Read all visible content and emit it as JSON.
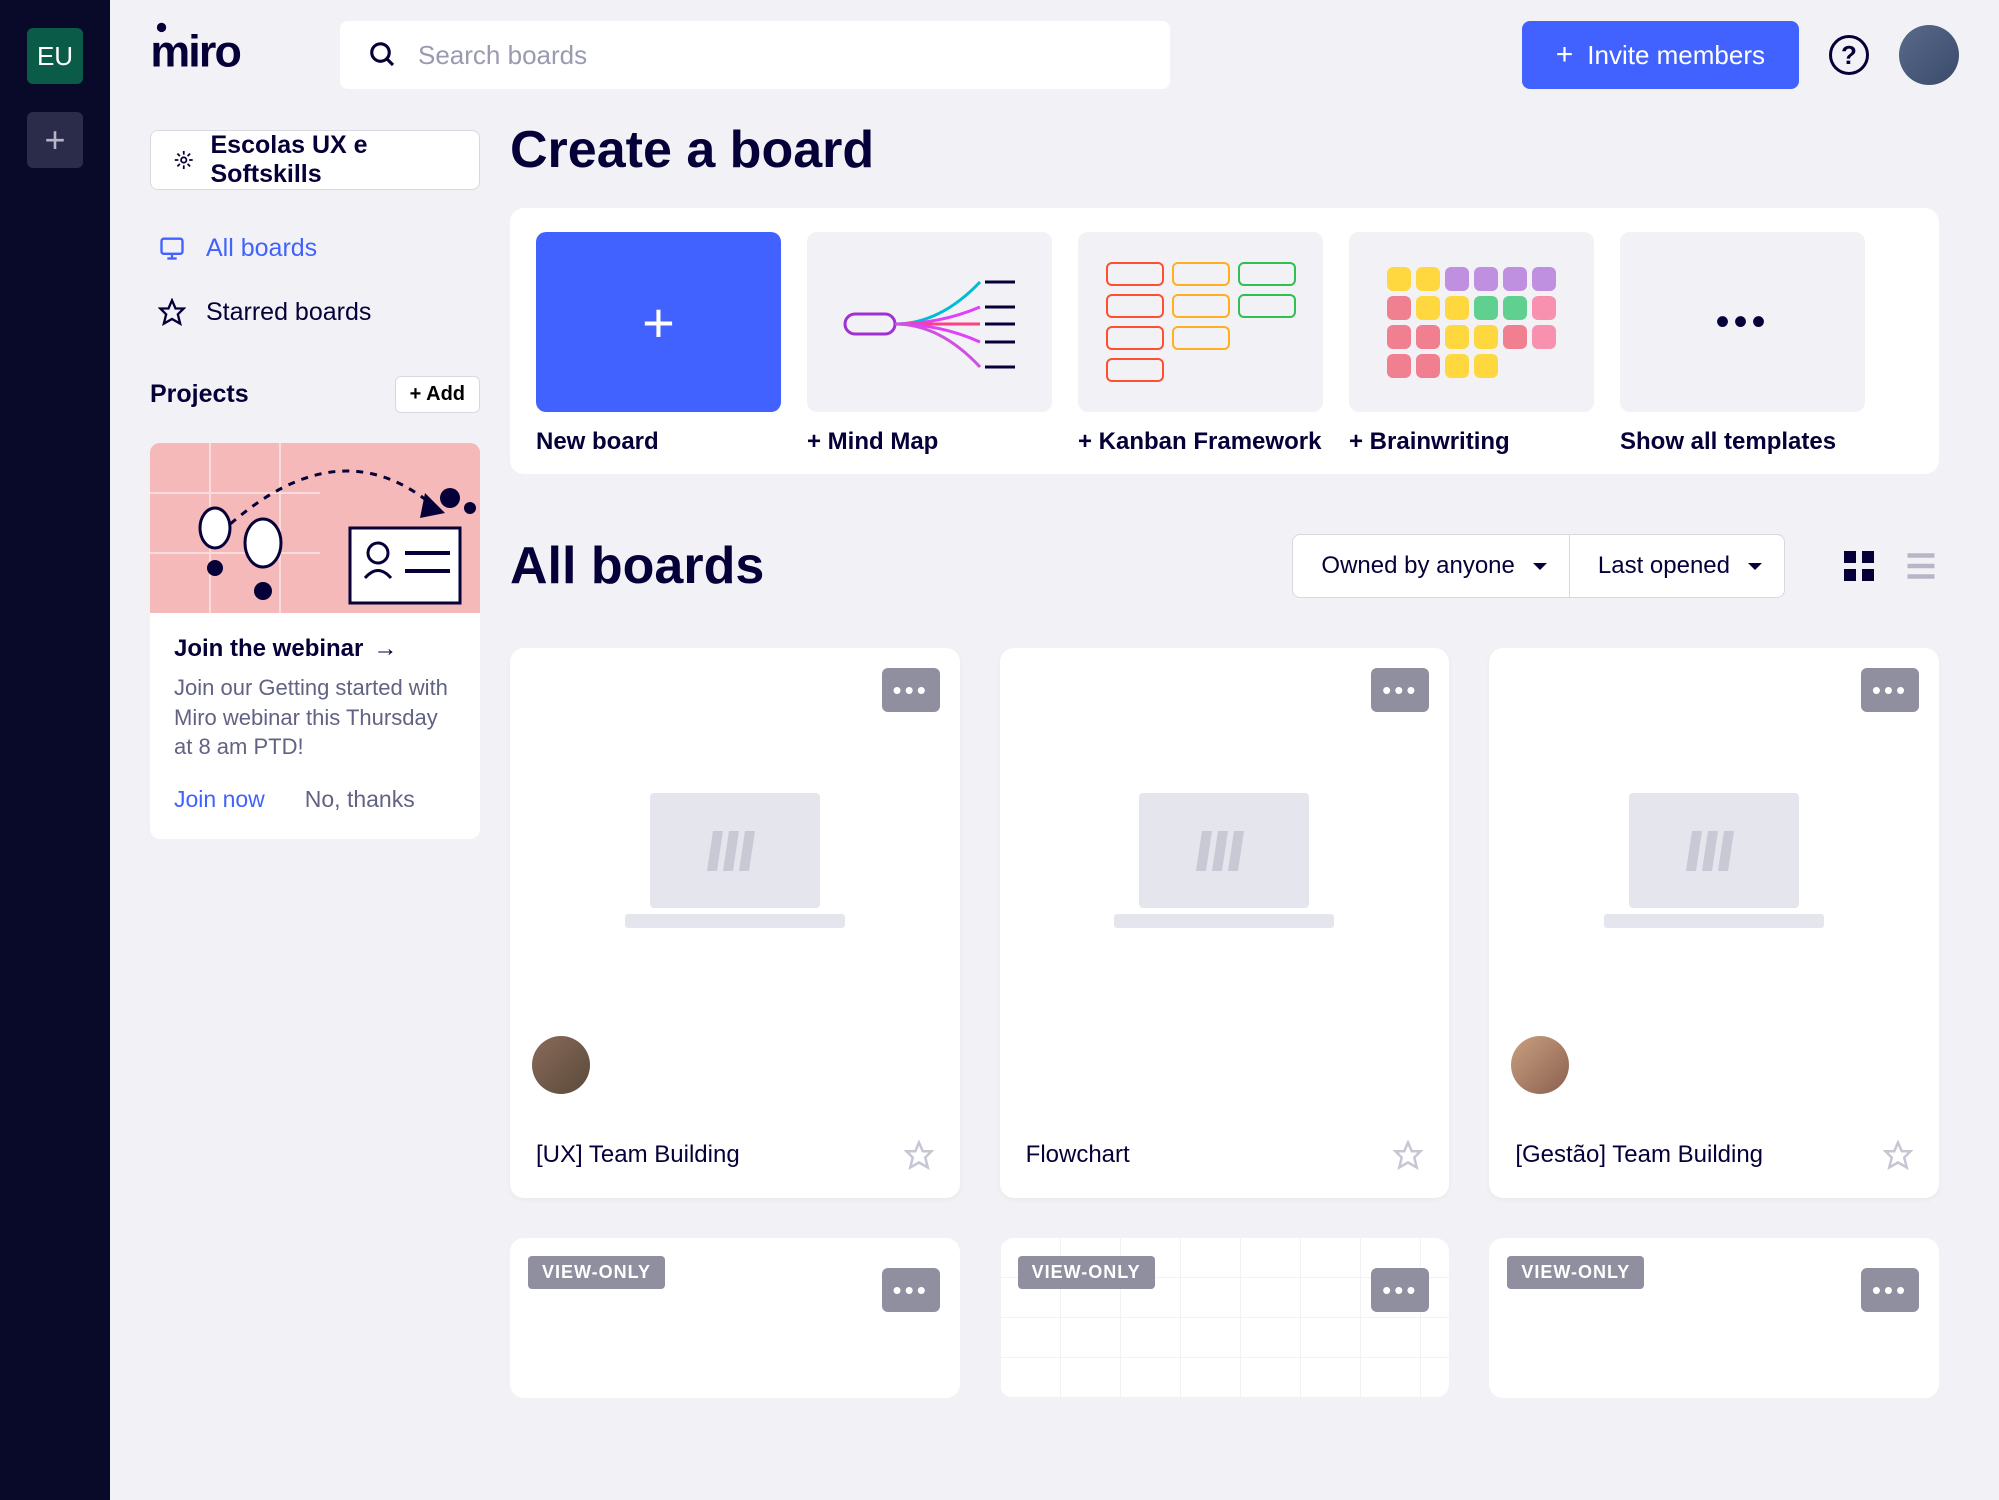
{
  "rail": {
    "badge": "EU"
  },
  "header": {
    "logo_text": "miro",
    "search_placeholder": "Search boards",
    "invite_label": "Invite members"
  },
  "sidebar": {
    "team_label": "Escolas UX e Softskills",
    "nav": {
      "all_boards": "All boards",
      "starred": "Starred boards"
    },
    "projects": {
      "title": "Projects",
      "add_label": "+ Add"
    },
    "webinar": {
      "title": "Join the webinar",
      "desc": "Join our Getting started with Miro webinar this Thursday at 8 am PTD!",
      "join": "Join now",
      "dismiss": "No, thanks"
    }
  },
  "create": {
    "title": "Create a board",
    "items": [
      {
        "label": "New board"
      },
      {
        "label": "+ Mind Map"
      },
      {
        "label": "+ Kanban Framework"
      },
      {
        "label": "+ Brainwriting"
      },
      {
        "label": "Show all templates"
      }
    ]
  },
  "boards": {
    "title": "All boards",
    "filters": {
      "owner": "Owned by anyone",
      "sort": "Last opened"
    },
    "cards": [
      {
        "title": "[UX] Team Building",
        "has_avatar": true
      },
      {
        "title": "Flowchart",
        "has_avatar": false
      },
      {
        "title": "[Gestão] Team Building",
        "has_avatar": true
      }
    ],
    "view_only_label": "VIEW-ONLY"
  }
}
